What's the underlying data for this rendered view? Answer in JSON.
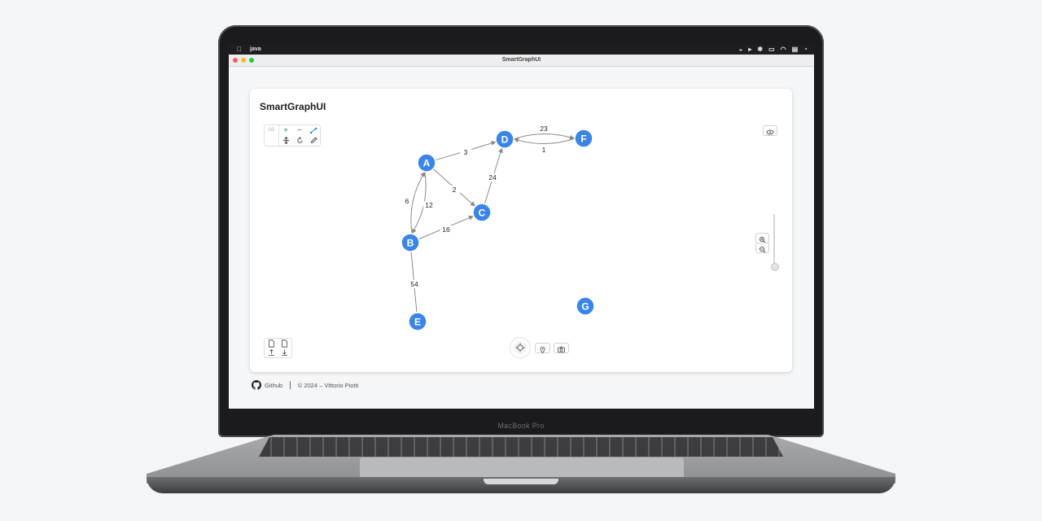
{
  "device": {
    "brand_label": "MacBook Pro"
  },
  "menubar": {
    "app_name": "java"
  },
  "window": {
    "title": "SmartGraphUI",
    "traffic_lights": [
      "#fe5f57",
      "#febc2e",
      "#28c840"
    ]
  },
  "card": {
    "title": "SmartGraphUI"
  },
  "toolbar": {
    "ab_label": "AB",
    "add_symbol": "+",
    "remove_symbol": "−",
    "add_color": "#2f9e44",
    "remove_color": "#e03131"
  },
  "graph": {
    "node_color": "#3a86e8",
    "nodes": [
      {
        "id": "A",
        "label": "A"
      },
      {
        "id": "B",
        "label": "B"
      },
      {
        "id": "C",
        "label": "C"
      },
      {
        "id": "D",
        "label": "D"
      },
      {
        "id": "E",
        "label": "E"
      },
      {
        "id": "F",
        "label": "F"
      },
      {
        "id": "G",
        "label": "G"
      }
    ],
    "edges": [
      {
        "from": "A",
        "to": "D",
        "weight": "3"
      },
      {
        "from": "A",
        "to": "C",
        "weight": "2"
      },
      {
        "from": "A",
        "to": "B",
        "weight": "6"
      },
      {
        "from": "B",
        "to": "A",
        "weight": "12"
      },
      {
        "from": "B",
        "to": "C",
        "weight": "16"
      },
      {
        "from": "C",
        "to": "D",
        "weight": "24"
      },
      {
        "from": "D",
        "to": "F",
        "weight": "23"
      },
      {
        "from": "F",
        "to": "D",
        "weight": "1"
      },
      {
        "from": "B",
        "to": "E",
        "weight": "54"
      }
    ]
  },
  "footer": {
    "github_label": "Github",
    "separator": "|",
    "copyright": "© 2024 – Vittorio Piotti"
  }
}
